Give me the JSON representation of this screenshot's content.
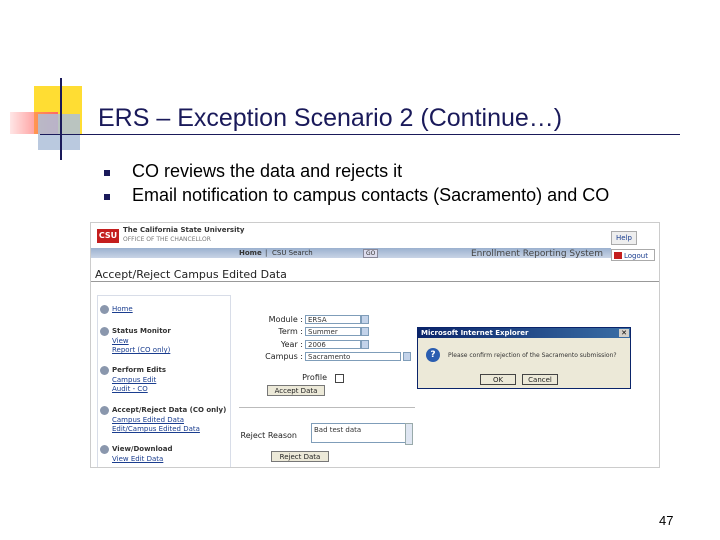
{
  "slide": {
    "title": "ERS – Exception Scenario 2 (Continue…)",
    "bullets": [
      "CO reviews the data and rejects it",
      "Email notification to campus contacts (Sacramento) and CO"
    ],
    "page_number": "47"
  },
  "screenshot": {
    "logo": "CSU",
    "logo_title": "The California State University",
    "logo_subtitle": "OFFICE OF THE CHANCELLOR",
    "nav": {
      "home": "Home",
      "separator": "|",
      "search": "CSU Search",
      "go": "GO"
    },
    "system_name": "Enrollment Reporting System",
    "help_label": "Help",
    "logout_label": "Logout",
    "page_heading": "Accept/Reject Campus Edited Data",
    "sidebar": {
      "home": "Home",
      "status_monitor": "Status Monitor",
      "status_links": [
        "View",
        "Report (CO only)"
      ],
      "perform_edits": "Perform Edits",
      "edit_links": [
        "Campus Edit",
        "Audit - CO"
      ],
      "accept_reject": "Accept/Reject Data (CO only)",
      "accept_links": [
        "Campus Edited Data",
        "Edit/Campus Edited Data"
      ],
      "view_download": "View/Download",
      "view_links": [
        "View Edit Data"
      ]
    },
    "form": {
      "module_label": "Module :",
      "module_value": "ERSA",
      "term_label": "Term :",
      "term_value": "Summer",
      "year_label": "Year :",
      "year_value": "2006",
      "campus_label": "Campus :",
      "campus_value": "Sacramento",
      "profile_label": "Profile",
      "accept_button": "Accept Data",
      "reject_reason_label": "Reject Reason",
      "reject_reason_value": "Bad test data",
      "reject_button": "Reject Data"
    },
    "dialog": {
      "title": "Microsoft Internet Explorer",
      "icon": "?",
      "message": "Please confirm rejection of the Sacramento submission?",
      "ok": "OK",
      "cancel": "Cancel"
    }
  },
  "colors": {
    "title_navy": "#1a1a5a",
    "csu_red": "#c41e1e",
    "decor_yellow": "#ffdd33",
    "decor_blue": "#aebfd9"
  },
  "icons": [
    "bullet-square-icon",
    "help-icon",
    "logout-icon",
    "question-icon",
    "home-icon",
    "status-icon",
    "edit-icon",
    "accept-icon",
    "view-icon"
  ]
}
